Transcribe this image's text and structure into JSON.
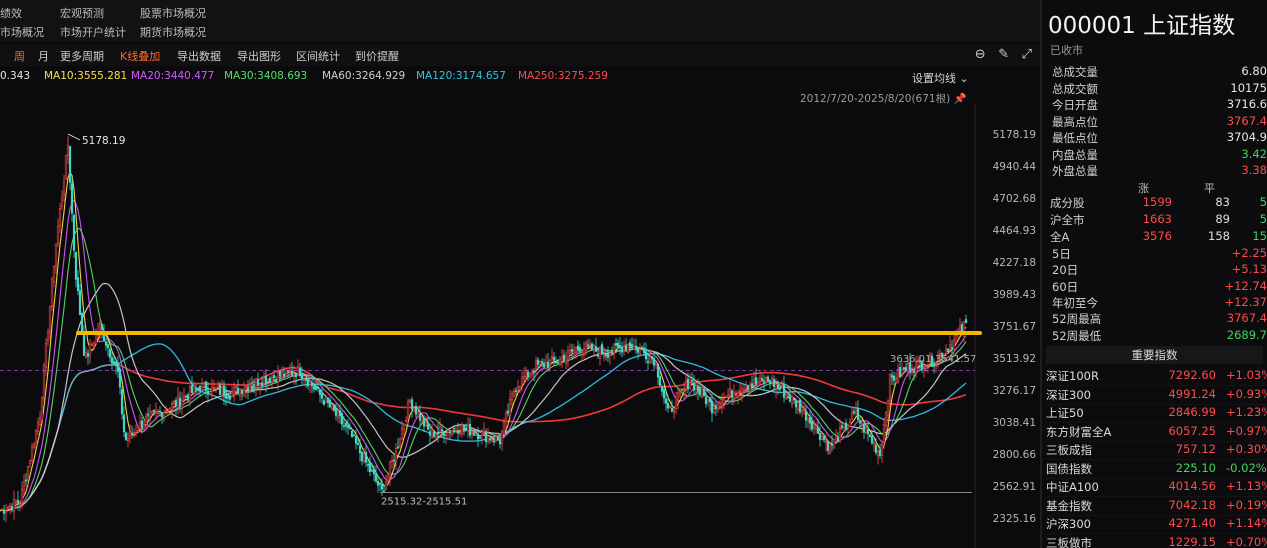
{
  "top_menu": {
    "row1": [
      "绩效",
      "宏观预测",
      "股票市场概况"
    ],
    "row2": [
      "市场概况",
      "市场开户统计",
      "期货市场概况"
    ]
  },
  "toolbar": {
    "buttons": [
      "周",
      "月",
      "更多周期",
      "K线叠加",
      "导出数据",
      "导出图形",
      "区间统计",
      "到价提醒"
    ],
    "active_buttons": [
      "周",
      "K线叠加"
    ],
    "icons": [
      "minimize-icon",
      "pen-icon",
      "expand-icon"
    ]
  },
  "ma_legend": [
    {
      "label": "0.343",
      "color": "#e8e8e8"
    },
    {
      "label": "MA10:3555.281",
      "color": "#f6e14a"
    },
    {
      "label": "MA20:3440.477",
      "color": "#d35bff"
    },
    {
      "label": "MA30:3408.693",
      "color": "#55e066"
    },
    {
      "label": "MA60:3264.929",
      "color": "#d0d0d0"
    },
    {
      "label": "MA120:3174.657",
      "color": "#33c6e6"
    },
    {
      "label": "MA250:3275.259",
      "color": "#ff4b4b"
    }
  ],
  "settings_label": "设置均线",
  "date_range": "2012/7/20-2025/8/20(671根)",
  "chart_data": {
    "type": "line",
    "subtype": "candlestick-weekly",
    "yticks": [
      5178.19,
      4940.44,
      4702.68,
      4464.93,
      4227.18,
      3989.43,
      3751.67,
      3513.92,
      3276.17,
      3038.41,
      2800.66,
      2562.91,
      2325.16
    ],
    "ylim": [
      2290,
      5250
    ],
    "annotations": {
      "high": "5178.19",
      "low": "2515.32-2515.51",
      "recent": "3636.01-3541.57"
    },
    "horizontal_line_value": 3700,
    "horizontal_line_color": "#f5b800",
    "dashed_line_value": 3420,
    "low_line_value": 2515
  },
  "quote": {
    "title": "000001 上证指数",
    "status": "已收市",
    "stats": [
      {
        "label": "总成交量",
        "value": "6.80",
        "color": "#e8e8e8"
      },
      {
        "label": "总成交额",
        "value": "10175",
        "color": "#e8e8e8"
      },
      {
        "label": "今日开盘",
        "value": "3716.6",
        "color": "#e8e8e8"
      },
      {
        "label": "最高点位",
        "value": "3767.4",
        "color": "#ff4b4b"
      },
      {
        "label": "最低点位",
        "value": "3704.9",
        "color": "#e8e8e8"
      },
      {
        "label": "内盘总量",
        "value": "3.42",
        "color": "#3ed65c"
      },
      {
        "label": "外盘总量",
        "value": "3.38",
        "color": "#ff4b4b"
      }
    ],
    "breadth_headers": [
      "涨",
      "平"
    ],
    "breadth": [
      {
        "label": "成分股",
        "up": "1599",
        "flat": "83",
        "down": "5"
      },
      {
        "label": "沪全市",
        "up": "1663",
        "flat": "89",
        "down": "5"
      },
      {
        "label": "全A",
        "up": "3576",
        "flat": "158",
        "down": "15"
      }
    ],
    "periods": [
      {
        "label": "5日",
        "value": "+2.25",
        "color": "#ff4b4b"
      },
      {
        "label": "20日",
        "value": "+5.13",
        "color": "#ff4b4b"
      },
      {
        "label": "60日",
        "value": "+12.74",
        "color": "#ff4b4b"
      },
      {
        "label": "年初至今",
        "value": "+12.37",
        "color": "#ff4b4b"
      },
      {
        "label": "52周最高",
        "value": "3767.4",
        "color": "#ff4b4b"
      },
      {
        "label": "52周最低",
        "value": "2689.7",
        "color": "#3ed65c"
      }
    ],
    "indices_title": "重要指数",
    "indices": [
      {
        "name": "深证100R",
        "price": "7292.60",
        "change": "+1.03%",
        "color": "#ff4b4b"
      },
      {
        "name": "深证300",
        "price": "4991.24",
        "change": "+0.93%",
        "color": "#ff4b4b"
      },
      {
        "name": "上证50",
        "price": "2846.99",
        "change": "+1.23%",
        "color": "#ff4b4b"
      },
      {
        "name": "东方财富全A",
        "price": "6057.25",
        "change": "+0.97%",
        "color": "#ff4b4b"
      },
      {
        "name": "三板成指",
        "price": "757.12",
        "change": "+0.30%",
        "color": "#ff4b4b"
      },
      {
        "name": "国债指数",
        "price": "225.10",
        "change": "-0.02%",
        "color": "#3ed65c"
      },
      {
        "name": "中证A100",
        "price": "4014.56",
        "change": "+1.13%",
        "color": "#ff4b4b"
      },
      {
        "name": "基金指数",
        "price": "7042.18",
        "change": "+0.19%",
        "color": "#ff4b4b"
      },
      {
        "name": "沪深300",
        "price": "4271.40",
        "change": "+1.14%",
        "color": "#ff4b4b"
      },
      {
        "name": "三板做市",
        "price": "1229.15",
        "change": "+0.70%",
        "color": "#ff4b4b"
      }
    ]
  }
}
